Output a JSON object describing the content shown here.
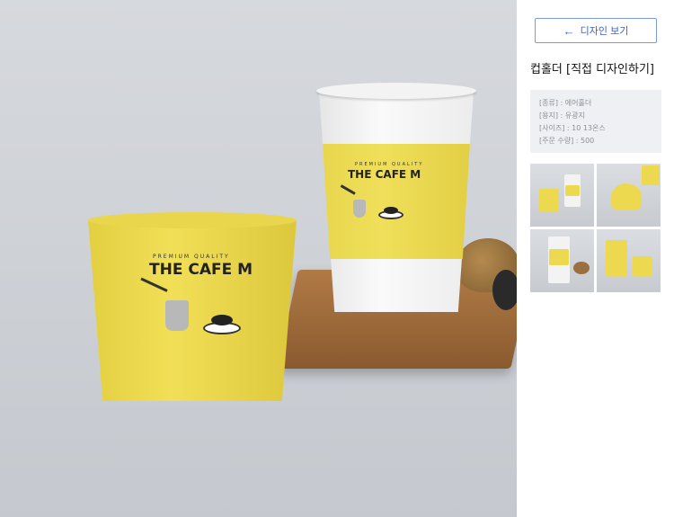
{
  "hero": {
    "tall_cup": {
      "tagline": "PREMIUM QUALITY",
      "brand": "THE CAFE M"
    },
    "short_cup": {
      "tagline": "PREMIUM QUALITY",
      "brand": "THE CAFE M"
    }
  },
  "panel": {
    "view_button": "디자인 보기",
    "title": "컵홀더 [직접 디자인하기]",
    "info": [
      "[종류] : 에어홀더",
      "[용지] : 유광지",
      "[사이즈] : 10 13온스",
      "[주문 수량] : 500"
    ]
  },
  "colors": {
    "accent": "#3f63c8",
    "sleeve": "#ecd94f"
  },
  "icons": {
    "back": "arrow-left-icon"
  }
}
